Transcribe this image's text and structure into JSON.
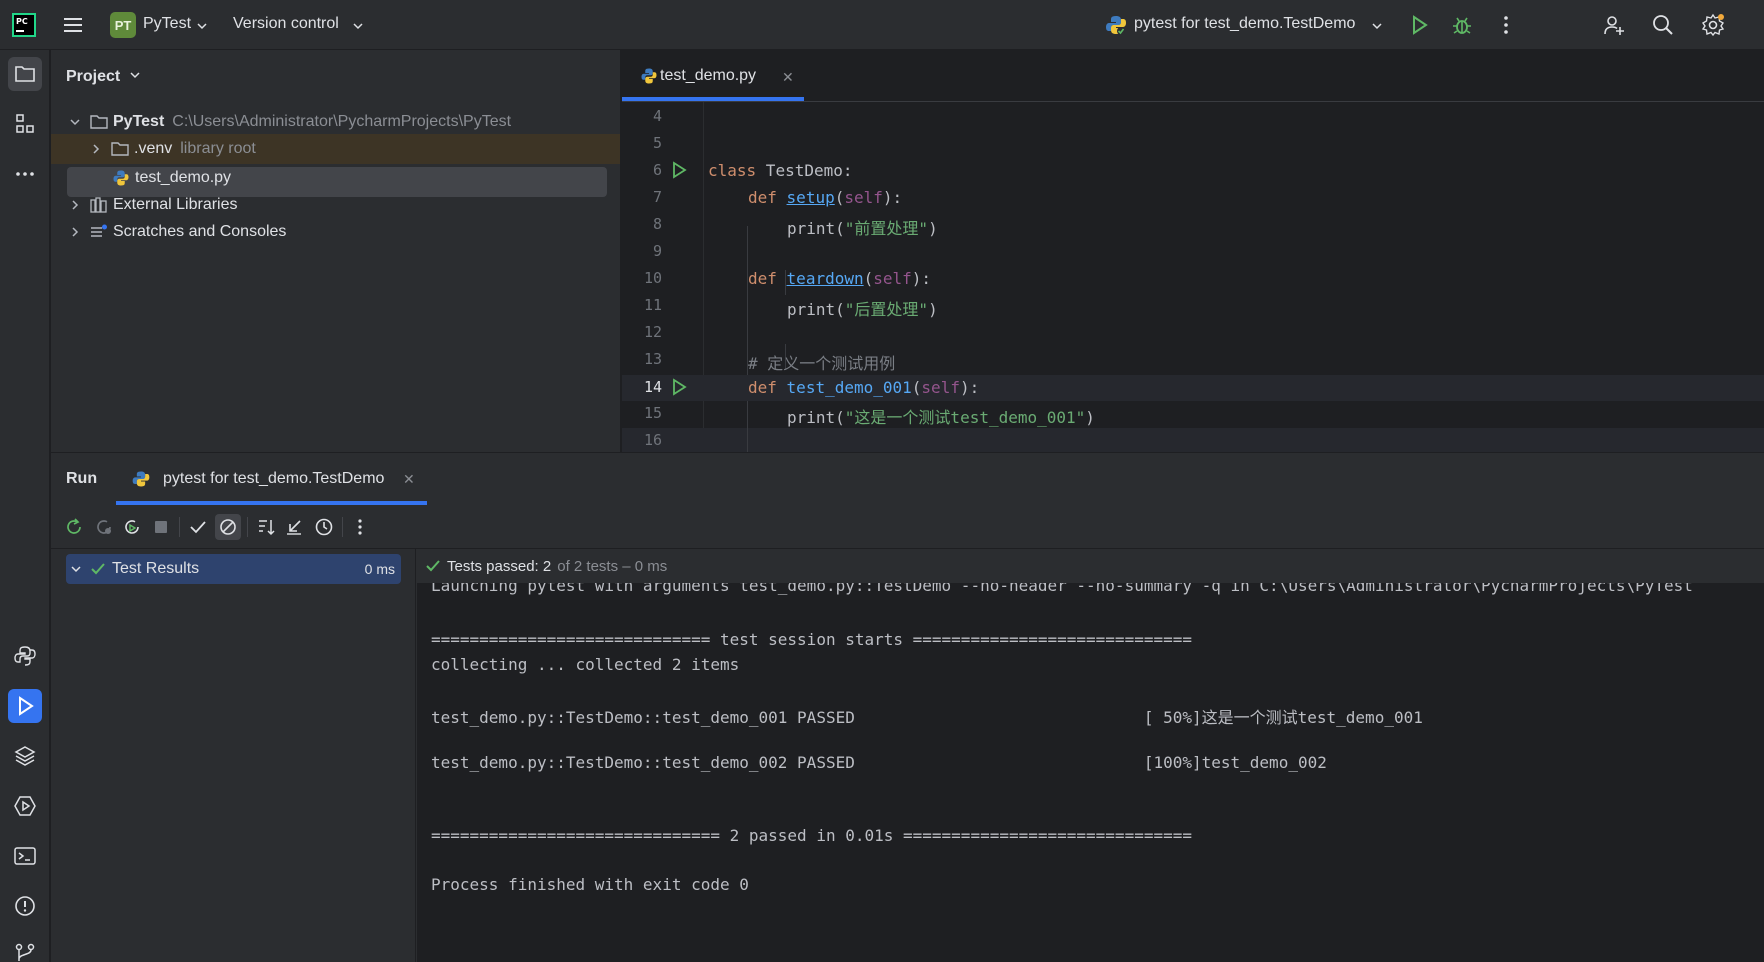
{
  "titlebar": {
    "project_badge": "PT",
    "project_name": "PyTest",
    "version_control": "Version control",
    "run_config": "pytest for test_demo.TestDemo"
  },
  "project_panel": {
    "title": "Project",
    "tree": {
      "root_name": "PyTest",
      "root_path": "C:\\Users\\Administrator\\PycharmProjects\\PyTest",
      "venv_name": ".venv",
      "venv_note": "library root",
      "file_name": "test_demo.py",
      "external_libraries": "External Libraries",
      "scratches": "Scratches and Consoles"
    }
  },
  "editor": {
    "tab_label": "test_demo.py",
    "lines": [
      {
        "n": "4"
      },
      {
        "n": "5"
      },
      {
        "n": "6"
      },
      {
        "n": "7"
      },
      {
        "n": "8"
      },
      {
        "n": "9"
      },
      {
        "n": "10"
      },
      {
        "n": "11"
      },
      {
        "n": "12"
      },
      {
        "n": "13"
      },
      {
        "n": "14"
      },
      {
        "n": "15"
      },
      {
        "n": "16"
      }
    ],
    "code": {
      "l6_kw": "class",
      "l6_name": " TestDemo:",
      "l7_kw": "def",
      "l7_fn": "setup",
      "l7_self": "self",
      "l8_call": "print(",
      "l8_str": "\"前置处理\"",
      "l8_end": ")",
      "l10_kw": "def",
      "l10_fn": "teardown",
      "l10_self": "self",
      "l11_call": "print(",
      "l11_str": "\"后置处理\"",
      "l11_end": ")",
      "l13_cmt": "# 定义一个测试用例",
      "l14_kw": "def",
      "l14_fn": "test_demo_001",
      "l14_self": "self",
      "l15_call": "print(",
      "l15_str": "\"这是一个测试test_demo_001\"",
      "l15_end": ")"
    }
  },
  "run_window": {
    "title": "Run",
    "tab_label": "pytest for test_demo.TestDemo",
    "test_tree": {
      "root_label": "Test Results",
      "root_time": "0 ms"
    },
    "status": {
      "passed": "Tests passed: 2",
      "detail": "of 2 tests – 0 ms"
    },
    "console_lines": [
      "Launching pytest with arguments test_demo.py::TestDemo --no-header --no-summary -q in C:\\Users\\Administrator\\PycharmProjects\\PyTest",
      "",
      "============================= test session starts =============================",
      "collecting ... collected 2 items",
      "",
      "test_demo.py::TestDemo::test_demo_001 PASSED                              [ 50%]这是一个测试test_demo_001",
      "",
      "test_demo.py::TestDemo::test_demo_002 PASSED                              [100%]test_demo_002",
      "",
      "",
      "============================== 2 passed in 0.01s ==============================",
      "",
      "Process finished with exit code 0"
    ]
  },
  "colors": {
    "accent": "#3574f0",
    "success": "#5fb865",
    "keyword": "#cf8e6d",
    "function": "#56a8f5",
    "string": "#6aab73"
  }
}
